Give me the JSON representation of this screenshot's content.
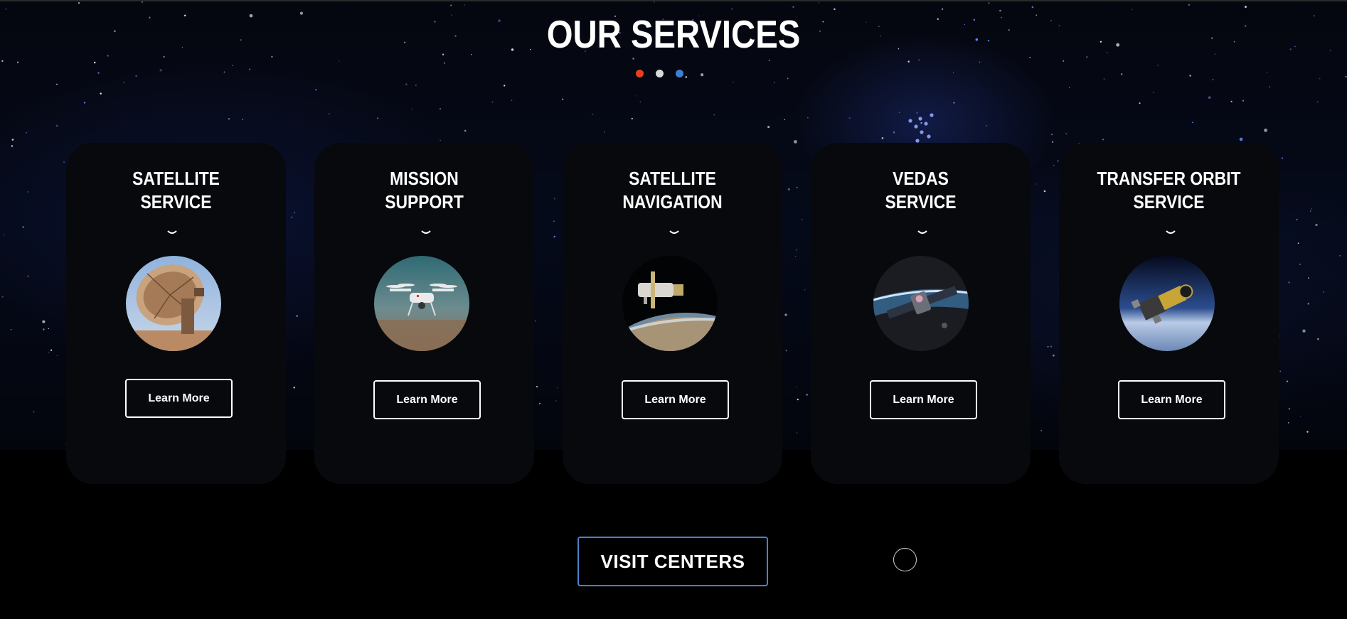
{
  "header": {
    "title": "OUR SERVICES",
    "dots": [
      {
        "name": "indicator-dot-red",
        "color": "#e8401f"
      },
      {
        "name": "indicator-dot-white",
        "color": "#d9d9d9"
      },
      {
        "name": "indicator-dot-blue",
        "color": "#3d7ed6"
      }
    ]
  },
  "cards": [
    {
      "title_line1": "SATELLITE",
      "title_line2": "SERVICE",
      "image": "radio-telescope-dish-image",
      "button": "Learn More"
    },
    {
      "title_line1": "MISSION",
      "title_line2": "SUPPORT",
      "image": "drone-image",
      "button": "Learn More"
    },
    {
      "title_line1": "SATELLITE",
      "title_line2": "NAVIGATION",
      "image": "space-telescope-over-earth-image",
      "button": "Learn More"
    },
    {
      "title_line1": "VEDAS",
      "title_line2": "SERVICE",
      "image": "satellite-over-earth-image",
      "button": "Learn More"
    },
    {
      "title_line1": "TRANSFER ORBIT",
      "title_line2": "SERVICE",
      "image": "spacecraft-in-orbit-image",
      "button": "Learn More"
    }
  ],
  "footer": {
    "visit_label": "VISIT CENTERS",
    "round_button": "circle-button"
  },
  "colors": {
    "card_bg": "#07090d",
    "visit_border": "#4f7ecb",
    "page_bg": "#000000"
  }
}
